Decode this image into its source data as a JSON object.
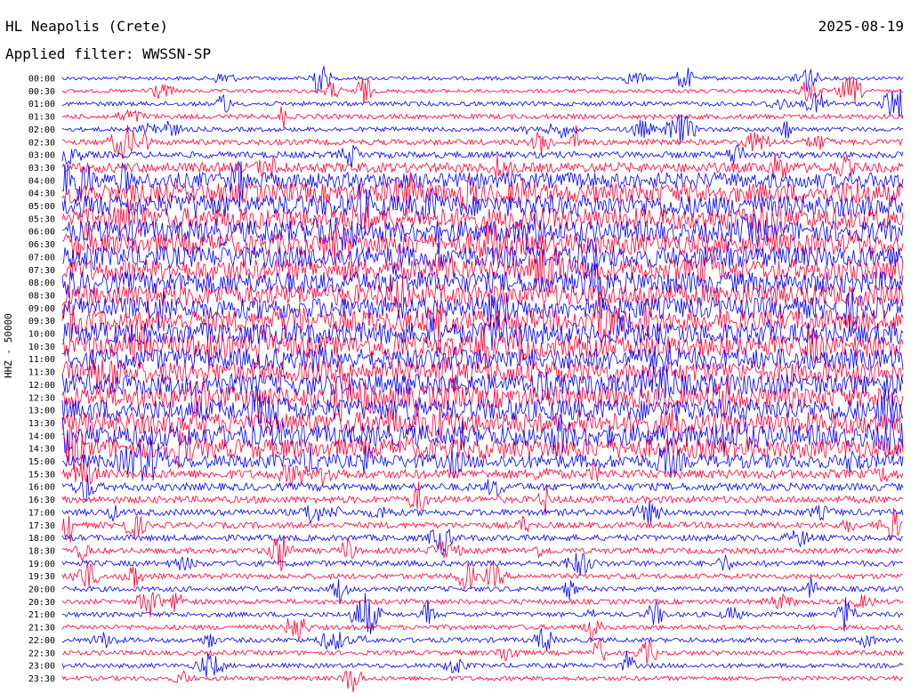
{
  "header": {
    "station": "HL Neapolis (Crete)",
    "date": "2025-08-19",
    "filter": "Applied filter: WWSSN-SP"
  },
  "colors": {
    "trace_a": "#0000ff",
    "trace_b": "#ff0033",
    "background": "#ffffff",
    "text": "#000000"
  },
  "chart_data": {
    "type": "line",
    "title": "HL Neapolis (Crete)",
    "subtitle": "Applied filter: WWSSN-SP",
    "date": "2025-08-19",
    "ylabel": "HHZ - 50000",
    "row_labels": [
      "00:00",
      "00:30",
      "01:00",
      "01:30",
      "02:00",
      "02:30",
      "03:00",
      "03:30",
      "04:00",
      "04:30",
      "05:00",
      "05:30",
      "06:00",
      "06:30",
      "07:00",
      "07:30",
      "08:00",
      "08:30",
      "09:00",
      "09:30",
      "10:00",
      "10:30",
      "11:00",
      "11:30",
      "12:00",
      "12:30",
      "13:00",
      "13:30",
      "14:00",
      "14:30",
      "15:00",
      "15:30",
      "16:00",
      "16:30",
      "17:00",
      "17:30",
      "18:00",
      "18:30",
      "19:00",
      "19:30",
      "20:00",
      "20:30",
      "21:00",
      "21:30",
      "22:00",
      "22:30",
      "23:00",
      "23:30"
    ],
    "row_interval_minutes": 30,
    "series_colors": [
      "#0000ff",
      "#ff0033"
    ],
    "noise_level": [
      0.08,
      0.08,
      0.12,
      0.14,
      0.12,
      0.18,
      0.22,
      0.4,
      0.7,
      0.9,
      1.0,
      1.0,
      1.0,
      1.0,
      1.0,
      1.0,
      1.0,
      1.0,
      1.0,
      1.0,
      1.0,
      1.0,
      1.0,
      1.0,
      1.0,
      1.0,
      1.0,
      1.0,
      1.0,
      0.9,
      0.6,
      0.35,
      0.28,
      0.25,
      0.22,
      0.2,
      0.2,
      0.18,
      0.18,
      0.16,
      0.15,
      0.15,
      0.14,
      0.14,
      0.14,
      0.13,
      0.13,
      0.12
    ],
    "grid": false,
    "legend": "none"
  }
}
